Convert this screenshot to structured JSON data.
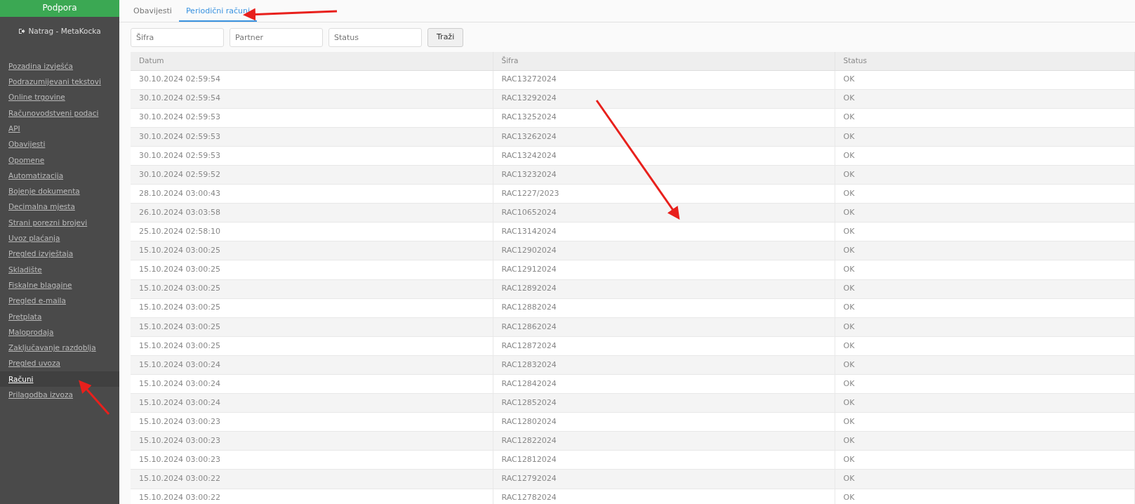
{
  "sidebar": {
    "title": "Podpora",
    "back_link": "Natrag - MetaKocka",
    "items": [
      {
        "label": "Pozadina izvješća",
        "selected": false
      },
      {
        "label": "Podrazumijevani tekstovi",
        "selected": false
      },
      {
        "label": "Online trgovine",
        "selected": false
      },
      {
        "label": "Računovodstveni podaci",
        "selected": false
      },
      {
        "label": "API",
        "selected": false
      },
      {
        "label": "Obavijesti",
        "selected": false
      },
      {
        "label": "Opomene",
        "selected": false
      },
      {
        "label": "Automatizacija",
        "selected": false
      },
      {
        "label": "Bojenje dokumenta",
        "selected": false
      },
      {
        "label": "Decimalna mjesta",
        "selected": false
      },
      {
        "label": "Strani porezni brojevi",
        "selected": false
      },
      {
        "label": "Uvoz plaćanja",
        "selected": false
      },
      {
        "label": "Pregled izvještaja",
        "selected": false
      },
      {
        "label": "Skladište",
        "selected": false
      },
      {
        "label": "Fiskalne blagajne",
        "selected": false
      },
      {
        "label": "Pregled e-maila",
        "selected": false
      },
      {
        "label": "Pretplata",
        "selected": false
      },
      {
        "label": "Maloprodaja",
        "selected": false
      },
      {
        "label": "Zaključavanje razdoblja",
        "selected": false
      },
      {
        "label": "Pregled uvoza",
        "selected": false
      },
      {
        "label": "Računi",
        "selected": true
      },
      {
        "label": "Prilagodba izvoza",
        "selected": false
      }
    ]
  },
  "tabs": [
    {
      "label": "Obavijesti",
      "selected": false
    },
    {
      "label": "Periodični računi",
      "selected": true
    }
  ],
  "filters": [
    {
      "placeholder": "Šifra"
    },
    {
      "placeholder": "Partner"
    },
    {
      "placeholder": "Status"
    }
  ],
  "search_button": "Traži",
  "table": {
    "columns": [
      "Datum",
      "Šifra",
      "Status"
    ],
    "rows": [
      [
        "30.10.2024 02:59:54",
        "RAC13272024",
        "OK"
      ],
      [
        "30.10.2024 02:59:54",
        "RAC13292024",
        "OK"
      ],
      [
        "30.10.2024 02:59:53",
        "RAC13252024",
        "OK"
      ],
      [
        "30.10.2024 02:59:53",
        "RAC13262024",
        "OK"
      ],
      [
        "30.10.2024 02:59:53",
        "RAC13242024",
        "OK"
      ],
      [
        "30.10.2024 02:59:52",
        "RAC13232024",
        "OK"
      ],
      [
        "28.10.2024 03:00:43",
        "RAC1227/2023",
        "OK"
      ],
      [
        "26.10.2024 03:03:58",
        "RAC10652024",
        "OK"
      ],
      [
        "25.10.2024 02:58:10",
        "RAC13142024",
        "OK"
      ],
      [
        "15.10.2024 03:00:25",
        "RAC12902024",
        "OK"
      ],
      [
        "15.10.2024 03:00:25",
        "RAC12912024",
        "OK"
      ],
      [
        "15.10.2024 03:00:25",
        "RAC12892024",
        "OK"
      ],
      [
        "15.10.2024 03:00:25",
        "RAC12882024",
        "OK"
      ],
      [
        "15.10.2024 03:00:25",
        "RAC12862024",
        "OK"
      ],
      [
        "15.10.2024 03:00:25",
        "RAC12872024",
        "OK"
      ],
      [
        "15.10.2024 03:00:24",
        "RAC12832024",
        "OK"
      ],
      [
        "15.10.2024 03:00:24",
        "RAC12842024",
        "OK"
      ],
      [
        "15.10.2024 03:00:24",
        "RAC12852024",
        "OK"
      ],
      [
        "15.10.2024 03:00:23",
        "RAC12802024",
        "OK"
      ],
      [
        "15.10.2024 03:00:23",
        "RAC12822024",
        "OK"
      ],
      [
        "15.10.2024 03:00:23",
        "RAC12812024",
        "OK"
      ],
      [
        "15.10.2024 03:00:22",
        "RAC12792024",
        "OK"
      ],
      [
        "15.10.2024 03:00:22",
        "RAC12782024",
        "OK"
      ]
    ]
  },
  "annotations": [
    {
      "kind": "arrow"
    },
    {
      "kind": "arrow"
    },
    {
      "kind": "arrow"
    }
  ]
}
